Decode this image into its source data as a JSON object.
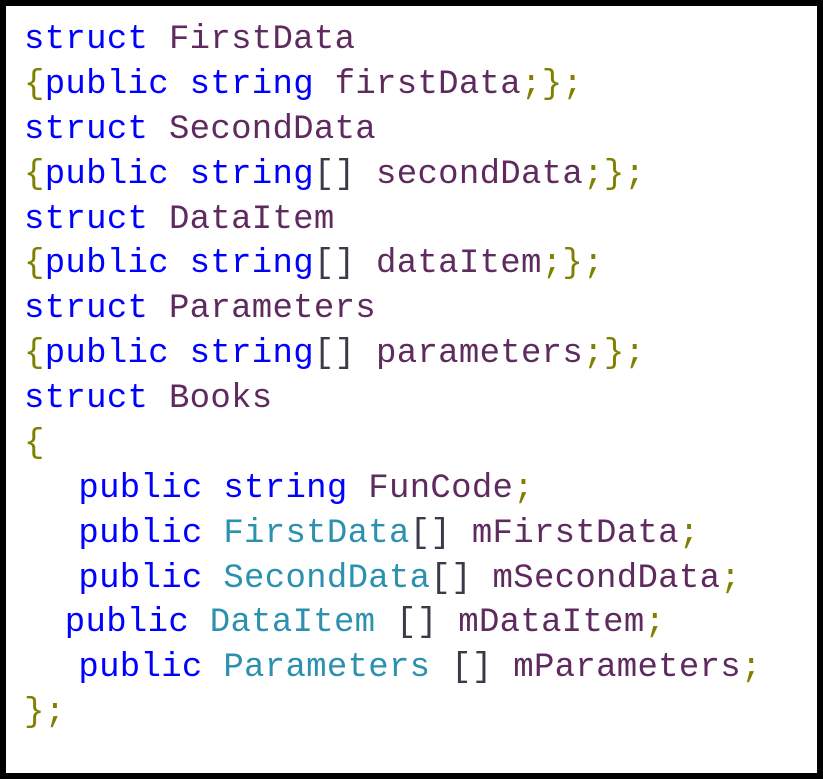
{
  "code": {
    "lines": [
      {
        "tokens": [
          {
            "t": "struct",
            "c": "keyword"
          },
          {
            "t": " ",
            "c": ""
          },
          {
            "t": "FirstData",
            "c": "usertype"
          }
        ]
      },
      {
        "tokens": [
          {
            "t": "{",
            "c": "punct"
          },
          {
            "t": "public",
            "c": "keyword"
          },
          {
            "t": " ",
            "c": ""
          },
          {
            "t": "string",
            "c": "keyword"
          },
          {
            "t": " ",
            "c": ""
          },
          {
            "t": "firstData",
            "c": "identifier"
          },
          {
            "t": ";",
            "c": "punct"
          },
          {
            "t": "}",
            "c": "punct"
          },
          {
            "t": ";",
            "c": "punct"
          }
        ]
      },
      {
        "tokens": [
          {
            "t": "struct",
            "c": "keyword"
          },
          {
            "t": " ",
            "c": ""
          },
          {
            "t": "SecondData",
            "c": "usertype"
          }
        ]
      },
      {
        "tokens": [
          {
            "t": "{",
            "c": "punct"
          },
          {
            "t": "public",
            "c": "keyword"
          },
          {
            "t": " ",
            "c": ""
          },
          {
            "t": "string",
            "c": "keyword"
          },
          {
            "t": "[]",
            "c": "brackets"
          },
          {
            "t": " ",
            "c": ""
          },
          {
            "t": "secondData",
            "c": "identifier"
          },
          {
            "t": ";",
            "c": "punct"
          },
          {
            "t": "}",
            "c": "punct"
          },
          {
            "t": ";",
            "c": "punct"
          }
        ]
      },
      {
        "tokens": [
          {
            "t": "struct",
            "c": "keyword"
          },
          {
            "t": " ",
            "c": ""
          },
          {
            "t": "DataItem",
            "c": "usertype"
          }
        ]
      },
      {
        "tokens": [
          {
            "t": "{",
            "c": "punct"
          },
          {
            "t": "public",
            "c": "keyword"
          },
          {
            "t": " ",
            "c": ""
          },
          {
            "t": "string",
            "c": "keyword"
          },
          {
            "t": "[]",
            "c": "brackets"
          },
          {
            "t": " ",
            "c": ""
          },
          {
            "t": "dataItem",
            "c": "identifier"
          },
          {
            "t": ";",
            "c": "punct"
          },
          {
            "t": "}",
            "c": "punct"
          },
          {
            "t": ";",
            "c": "punct"
          }
        ]
      },
      {
        "tokens": [
          {
            "t": "struct",
            "c": "keyword"
          },
          {
            "t": " ",
            "c": ""
          },
          {
            "t": "Parameters",
            "c": "usertype"
          }
        ]
      },
      {
        "tokens": [
          {
            "t": "{",
            "c": "punct"
          },
          {
            "t": "public",
            "c": "keyword"
          },
          {
            "t": " ",
            "c": ""
          },
          {
            "t": "string",
            "c": "keyword"
          },
          {
            "t": "[]",
            "c": "brackets"
          },
          {
            "t": " ",
            "c": ""
          },
          {
            "t": "parameters",
            "c": "identifier"
          },
          {
            "t": ";",
            "c": "punct"
          },
          {
            "t": "}",
            "c": "punct"
          },
          {
            "t": ";",
            "c": "punct"
          }
        ]
      },
      {
        "tokens": [
          {
            "t": "struct",
            "c": "keyword"
          },
          {
            "t": " ",
            "c": ""
          },
          {
            "t": "Books",
            "c": "usertype"
          }
        ]
      },
      {
        "tokens": [
          {
            "t": "{",
            "c": "punct"
          }
        ]
      },
      {
        "indent": "indent",
        "tokens": [
          {
            "t": "public",
            "c": "keyword"
          },
          {
            "t": " ",
            "c": ""
          },
          {
            "t": "string",
            "c": "keyword"
          },
          {
            "t": " ",
            "c": ""
          },
          {
            "t": "FunCode",
            "c": "identifier"
          },
          {
            "t": ";",
            "c": "punct"
          }
        ]
      },
      {
        "indent": "indent",
        "tokens": [
          {
            "t": "public",
            "c": "keyword"
          },
          {
            "t": " ",
            "c": ""
          },
          {
            "t": "FirstData",
            "c": "type"
          },
          {
            "t": "[]",
            "c": "brackets"
          },
          {
            "t": " ",
            "c": ""
          },
          {
            "t": "mFirstData",
            "c": "identifier"
          },
          {
            "t": ";",
            "c": "punct"
          }
        ]
      },
      {
        "indent": "indent",
        "tokens": [
          {
            "t": "public",
            "c": "keyword"
          },
          {
            "t": " ",
            "c": ""
          },
          {
            "t": "SecondData",
            "c": "type"
          },
          {
            "t": "[]",
            "c": "brackets"
          },
          {
            "t": " ",
            "c": ""
          },
          {
            "t": "mSecondData",
            "c": "identifier"
          },
          {
            "t": ";",
            "c": "punct"
          }
        ]
      },
      {
        "indent": "indent-small",
        "tokens": [
          {
            "t": "public",
            "c": "keyword"
          },
          {
            "t": " ",
            "c": ""
          },
          {
            "t": "DataItem",
            "c": "type"
          },
          {
            "t": " ",
            "c": ""
          },
          {
            "t": "[]",
            "c": "brackets"
          },
          {
            "t": " ",
            "c": ""
          },
          {
            "t": "mDataItem",
            "c": "identifier"
          },
          {
            "t": ";",
            "c": "punct"
          }
        ]
      },
      {
        "indent": "indent",
        "tokens": [
          {
            "t": "public",
            "c": "keyword"
          },
          {
            "t": " ",
            "c": ""
          },
          {
            "t": "Parameters",
            "c": "type"
          },
          {
            "t": " ",
            "c": ""
          },
          {
            "t": "[]",
            "c": "brackets"
          },
          {
            "t": " ",
            "c": ""
          },
          {
            "t": "mParameters",
            "c": "identifier"
          },
          {
            "t": ";",
            "c": "punct"
          }
        ]
      },
      {
        "tokens": [
          {
            "t": "}",
            "c": "punct"
          },
          {
            "t": ";",
            "c": "punct"
          }
        ]
      }
    ]
  }
}
